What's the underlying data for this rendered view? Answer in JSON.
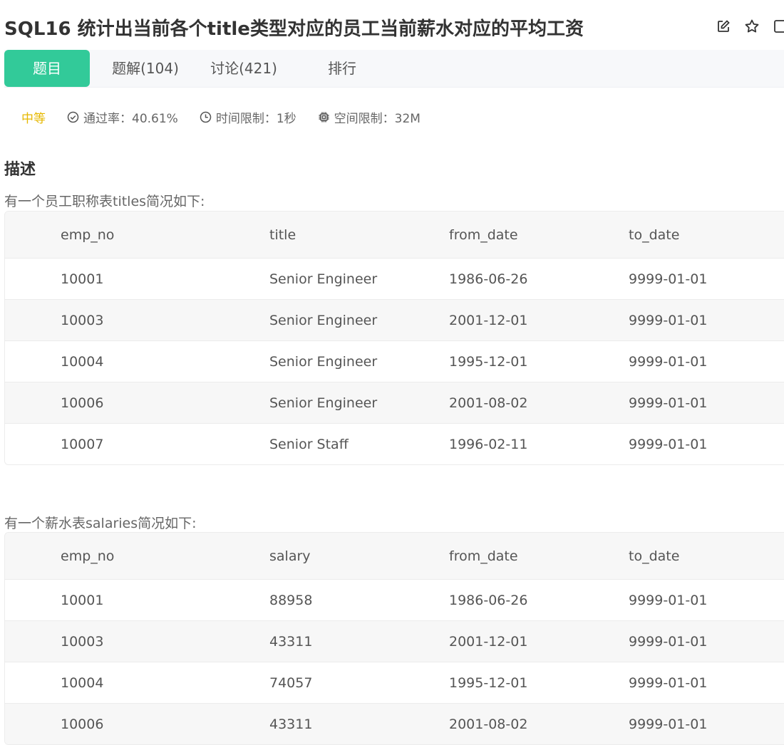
{
  "page": {
    "title": "SQL16  统计出当前各个title类型对应的员工当前薪水对应的平均工资"
  },
  "tabs": [
    {
      "label": "题目",
      "active": true
    },
    {
      "label": "题解(104)",
      "active": false
    },
    {
      "label": "讨论(421)",
      "active": false
    },
    {
      "label": "排行",
      "active": false
    }
  ],
  "meta": {
    "difficulty": "中等",
    "pass_rate": "通过率：40.61%",
    "time_limit": "时间限制：1秒",
    "memory_limit": "空间限制：32M"
  },
  "description": {
    "heading": "描述",
    "titles_intro": "有一个员工职称表titles简况如下:",
    "salaries_intro": "有一个薪水表salaries简况如下:"
  },
  "titles_table": {
    "headers": [
      "emp_no",
      "title",
      "from_date",
      "to_date"
    ],
    "rows": [
      [
        "10001",
        "Senior Engineer",
        "1986-06-26",
        "9999-01-01"
      ],
      [
        "10003",
        "Senior Engineer",
        "2001-12-01",
        "9999-01-01"
      ],
      [
        "10004",
        "Senior Engineer",
        "1995-12-01",
        "9999-01-01"
      ],
      [
        "10006",
        "Senior Engineer",
        "2001-08-02",
        "9999-01-01"
      ],
      [
        "10007",
        "Senior Staff",
        "1996-02-11",
        "9999-01-01"
      ]
    ]
  },
  "salaries_table": {
    "headers": [
      "emp_no",
      "salary",
      "from_date",
      "to_date"
    ],
    "rows": [
      [
        "10001",
        "88958",
        "1986-06-26",
        "9999-01-01"
      ],
      [
        "10003",
        "43311",
        "2001-12-01",
        "9999-01-01"
      ],
      [
        "10004",
        "74057",
        "1995-12-01",
        "9999-01-01"
      ],
      [
        "10006",
        "43311",
        "2001-08-02",
        "9999-01-01"
      ]
    ]
  },
  "colors": {
    "accent": "#32ca99",
    "difficulty": "#e6b800"
  },
  "icons": {
    "edit": "edit-icon",
    "star": "star-icon",
    "copy": "copy-icon",
    "pass_rate": "check-circle-icon",
    "time": "clock-icon",
    "memory": "chip-icon"
  }
}
